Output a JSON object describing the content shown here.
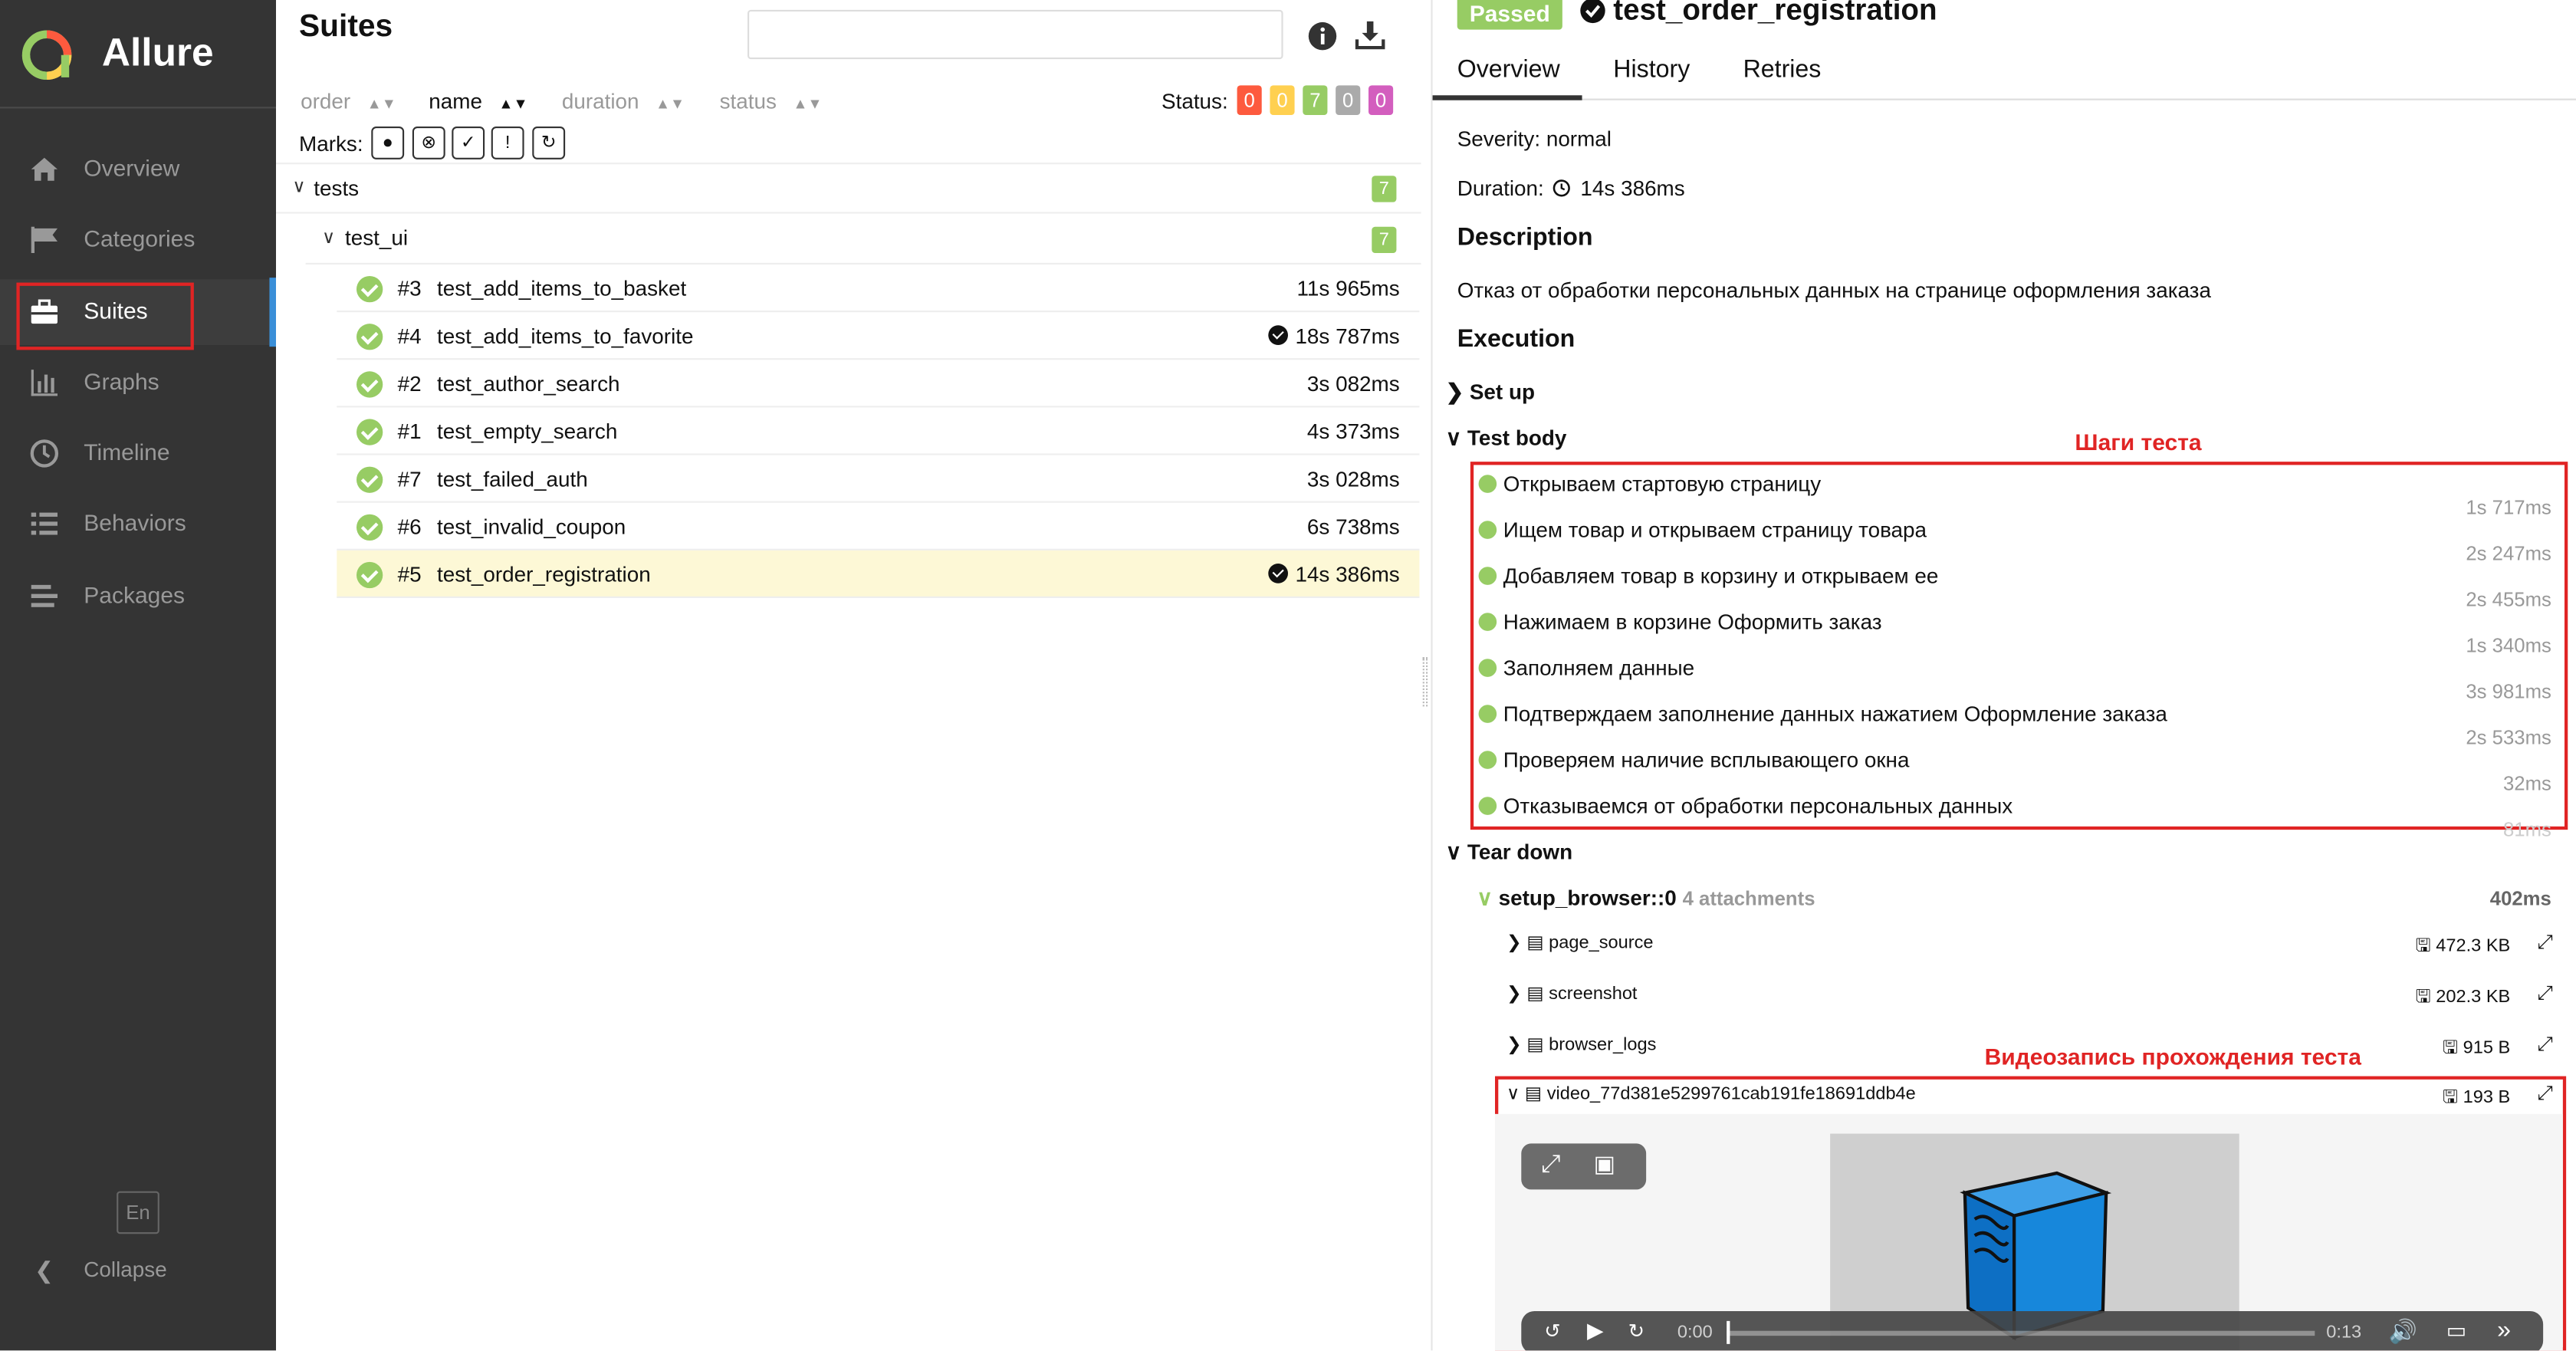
{
  "sidebar": {
    "brand": "Allure",
    "items": [
      {
        "label": "Overview",
        "icon": "home-icon"
      },
      {
        "label": "Categories",
        "icon": "flag-icon"
      },
      {
        "label": "Suites",
        "icon": "briefcase-icon"
      },
      {
        "label": "Graphs",
        "icon": "bar-chart-icon"
      },
      {
        "label": "Timeline",
        "icon": "clock-icon"
      },
      {
        "label": "Behaviors",
        "icon": "list-icon"
      },
      {
        "label": "Packages",
        "icon": "packages-icon"
      }
    ],
    "active": "Suites",
    "language": "En",
    "collapse": "Collapse"
  },
  "suites": {
    "title": "Suites",
    "search_value": "",
    "sort": {
      "order": "order",
      "name": "name",
      "duration": "duration",
      "status": "status"
    },
    "status_label": "Status:",
    "status_counts": [
      {
        "value": "0",
        "color": "#fd5a3e"
      },
      {
        "value": "0",
        "color": "#ffd050"
      },
      {
        "value": "7",
        "color": "#97cc64"
      },
      {
        "value": "0",
        "color": "#aaaaaa"
      },
      {
        "value": "0",
        "color": "#d35ebe"
      }
    ],
    "marks_label": "Marks:",
    "root": {
      "label": "tests",
      "count": "7"
    },
    "child": {
      "label": "test_ui",
      "count": "7"
    },
    "tests": [
      {
        "num": "#3",
        "name": "test_add_items_to_basket",
        "duration": "11s 965ms",
        "flaky": false
      },
      {
        "num": "#4",
        "name": "test_add_items_to_favorite",
        "duration": "18s 787ms",
        "flaky": true
      },
      {
        "num": "#2",
        "name": "test_author_search",
        "duration": "3s 082ms",
        "flaky": false
      },
      {
        "num": "#1",
        "name": "test_empty_search",
        "duration": "4s 373ms",
        "flaky": false
      },
      {
        "num": "#7",
        "name": "test_failed_auth",
        "duration": "3s 028ms",
        "flaky": false
      },
      {
        "num": "#6",
        "name": "test_invalid_coupon",
        "duration": "6s 738ms",
        "flaky": false
      },
      {
        "num": "#5",
        "name": "test_order_registration",
        "duration": "14s 386ms",
        "flaky": true
      }
    ]
  },
  "detail": {
    "status": "Passed",
    "title": "test_order_registration",
    "tabs": [
      "Overview",
      "History",
      "Retries"
    ],
    "severity": "Severity: normal",
    "duration_label": "Duration:",
    "duration": "14s 386ms",
    "description_heading": "Description",
    "description": "Отказ от обработки персональных данных на странице оформления заказа",
    "execution_heading": "Execution",
    "setup": "Set up",
    "test_body": "Test body",
    "steps_annotation": "Шаги теста",
    "steps": [
      {
        "name": "Открываем стартовую страницу",
        "duration": "1s 717ms"
      },
      {
        "name": "Ищем товар и открываем страницу товара",
        "duration": "2s 247ms"
      },
      {
        "name": "Добавляем товар в корзину и открываем ее",
        "duration": "2s 455ms"
      },
      {
        "name": "Нажимаем в корзине Оформить заказ",
        "duration": "1s 340ms"
      },
      {
        "name": "Заполняем данные",
        "duration": "3s 981ms"
      },
      {
        "name": "Подтверждаем заполнение данных нажатием Оформление заказа",
        "duration": "2s 533ms"
      },
      {
        "name": "Проверяем наличие всплывающего окна",
        "duration": "32ms"
      },
      {
        "name": "Отказываемся от обработки персональных данных",
        "duration": "81ms"
      }
    ],
    "teardown": "Tear down",
    "fixture": {
      "name": "setup_browser::0",
      "attachments": "4 attachments",
      "duration": "402ms"
    },
    "attachments": [
      {
        "name": "page_source",
        "size": "472.3 KB"
      },
      {
        "name": "screenshot",
        "size": "202.3 KB"
      },
      {
        "name": "browser_logs",
        "size": "915 B"
      },
      {
        "name": "video_77d381e5299761cab191fe18691ddb4e",
        "size": "193 B"
      }
    ],
    "video_annotation": "Видеозапись прохождения теста",
    "video": {
      "current": "0:00",
      "total": "0:13"
    }
  }
}
